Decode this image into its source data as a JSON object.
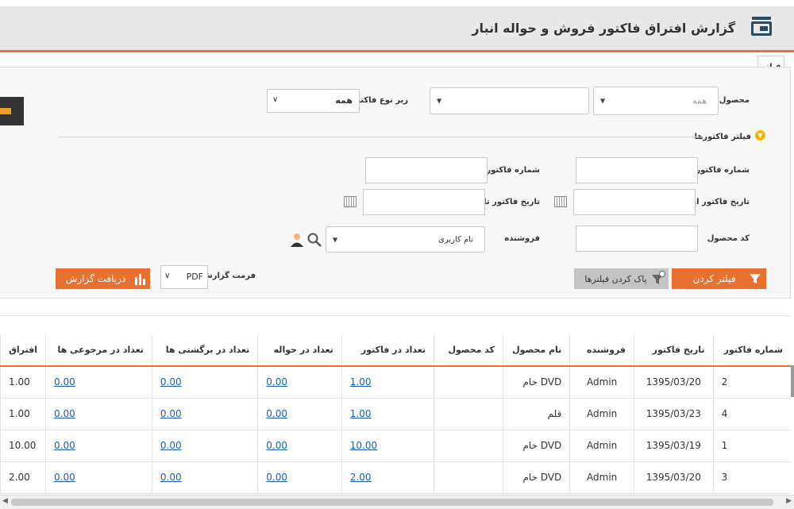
{
  "header": {
    "title": "گزارش افتراق فاکتور فروش و حواله انبار",
    "icon": "report-stack-icon"
  },
  "filter_tab": "فیلتر",
  "filters": {
    "product_label": "محصول",
    "product_value": "همه",
    "subtype_label": "زیر نوع فاکتور",
    "subtype_value": "همه",
    "section_title": "فیلتر فاکتورها",
    "invoice_from_label": "شماره فاکتور از",
    "invoice_to_label": "شماره فاکتور تا",
    "date_from_label": "تاریخ فاکتور از",
    "date_to_label": "تاریخ فاکتور تا",
    "product_code_label": "کد محصول",
    "seller_label": "فروشنده",
    "seller_placeholder": "نام کاربری",
    "format_label": "فرمت گزارش",
    "format_value": "PDF"
  },
  "buttons": {
    "filter": "فیلتر کردن",
    "clear": "پاک کردن فیلترها",
    "download": "دریافت گزارش"
  },
  "table": {
    "columns": [
      "شماره فاکتور",
      "تاریخ فاکتور",
      "فروشنده",
      "نام محصول",
      "کد محصول",
      "تعداد در فاکتور",
      "تعداد در حواله",
      "تعداد در برگشتی ها",
      "تعداد در مرجوعی ها",
      "افتراق"
    ],
    "rows": [
      [
        "2",
        "1395/03/20",
        "Admin",
        "DVD خام",
        "",
        "1.00",
        "0.00",
        "0.00",
        "0.00",
        "1.00"
      ],
      [
        "4",
        "1395/03/23",
        "Admin",
        "قلم",
        "",
        "1.00",
        "0.00",
        "0.00",
        "0.00",
        "1.00"
      ],
      [
        "1",
        "1395/03/19",
        "Admin",
        "DVD خام",
        "",
        "10.00",
        "0.00",
        "0.00",
        "0.00",
        "10.00"
      ],
      [
        "3",
        "1395/03/20",
        "Admin",
        "DVD خام",
        "",
        "2.00",
        "0.00",
        "0.00",
        "0.00",
        "2.00"
      ]
    ]
  },
  "colors": {
    "accent": "#e9702f",
    "link": "#1a5fb4"
  }
}
